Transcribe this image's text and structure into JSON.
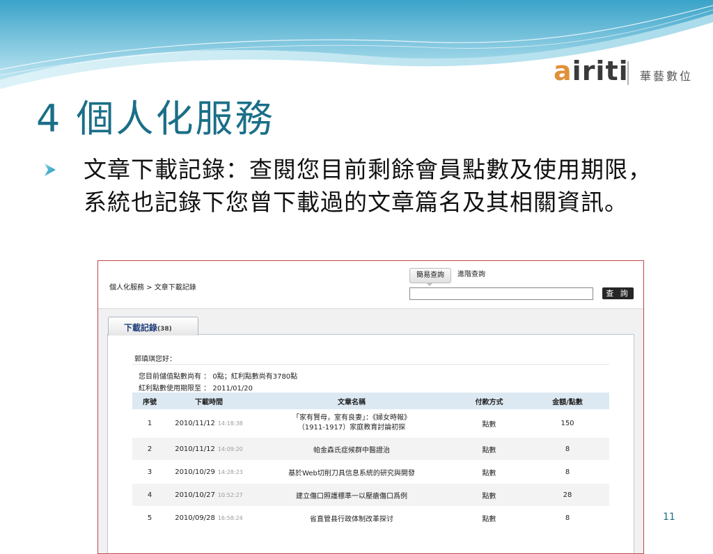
{
  "logo": {
    "word_a": "a",
    "word_i1": "i",
    "word_rest": "riti",
    "chinese": "華藝數位"
  },
  "slide": {
    "title": "4 個人化服務",
    "body": "文章下載記錄：查閱您目前剩餘會員點數及使用期限，系統也記錄下您曾下載過的文章篇名及其相關資訊。",
    "page_number": "11"
  },
  "embedded": {
    "breadcrumb": "個人化服務 > 文章下載記錄",
    "search": {
      "simple_tab": "簡易查詢",
      "advanced_tab": "進階查詢",
      "input_value": "",
      "button": "查 詢"
    },
    "download_tab": {
      "label": "下載記錄",
      "count": "(38)"
    },
    "greeting": "郭瑱琪您好：",
    "info_points": "您目前儲值點數尚有 ： 0點；紅利點數尚有3780點",
    "info_expiry": "紅利點數使用期限至 ： 2011/01/20",
    "table": {
      "headers": [
        "序號",
        "下載時間",
        "文章名稱",
        "付款方式",
        "金額/點數"
      ],
      "rows": [
        {
          "no": "1",
          "date": "2010/11/12",
          "time": "14:18:38",
          "title": "「家有賢母，室有良妻」：《婦女時報》（1911-1917）家庭教育討論初探",
          "payment": "點數",
          "amount": "150"
        },
        {
          "no": "2",
          "date": "2010/11/12",
          "time": "14:09:20",
          "title": "帕金森氏症候群中醫證治",
          "payment": "點數",
          "amount": "8"
        },
        {
          "no": "3",
          "date": "2010/10/29",
          "time": "14:28:23",
          "title": "基於Web切削刀具信息系統的研究與開發",
          "payment": "點數",
          "amount": "8"
        },
        {
          "no": "4",
          "date": "2010/10/27",
          "time": "10:52:27",
          "title": "建立傷口照護標準一以壓瘡傷口爲例",
          "payment": "點數",
          "amount": "28"
        },
        {
          "no": "5",
          "date": "2010/09/28",
          "time": "16:58:24",
          "title": "省直管县行政体制改革探讨",
          "payment": "點數",
          "amount": "8"
        }
      ]
    }
  }
}
